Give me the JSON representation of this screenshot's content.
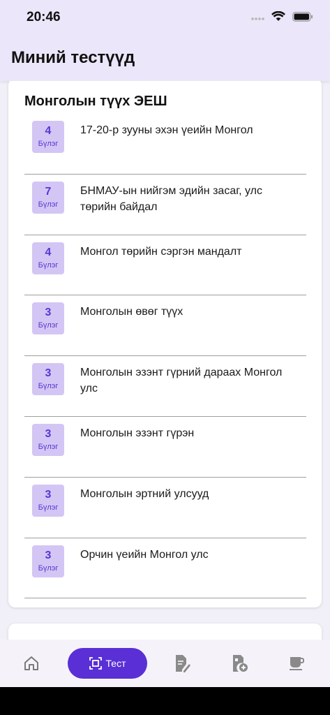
{
  "status_bar": {
    "time": "20:46"
  },
  "header": {
    "title": "Миний тестүүд"
  },
  "section": {
    "title": "Монголын түүх ЭЕШ",
    "unit_label": "Бүлэг",
    "chapters": [
      {
        "count": "4",
        "title": "17-20-р зууны эхэн үеийн Монгол"
      },
      {
        "count": "7",
        "title": "БНМАУ-ын нийгэм эдийн засаг, улс төрийн байдал"
      },
      {
        "count": "4",
        "title": "Монгол төрийн сэргэн мандалт"
      },
      {
        "count": "3",
        "title": "Монголын өвөг түүх"
      },
      {
        "count": "3",
        "title": "Монголын эзэнт гүрний дараах Монгол улс"
      },
      {
        "count": "3",
        "title": "Монголын эзэнт гүрэн"
      },
      {
        "count": "3",
        "title": "Монголын эртний улсууд"
      },
      {
        "count": "3",
        "title": "Орчин үеийн Монгол улс"
      }
    ]
  },
  "bottom_nav": {
    "items": [
      {
        "icon": "home-icon"
      },
      {
        "icon": "test-icon",
        "label": "Тест",
        "active": true
      },
      {
        "icon": "edit-document-icon"
      },
      {
        "icon": "add-document-icon"
      },
      {
        "icon": "coffee-icon"
      }
    ]
  },
  "colors": {
    "accent": "#5a2fd6",
    "badge_bg": "#d3c6f4",
    "header_bg": "#ebe6f9"
  }
}
